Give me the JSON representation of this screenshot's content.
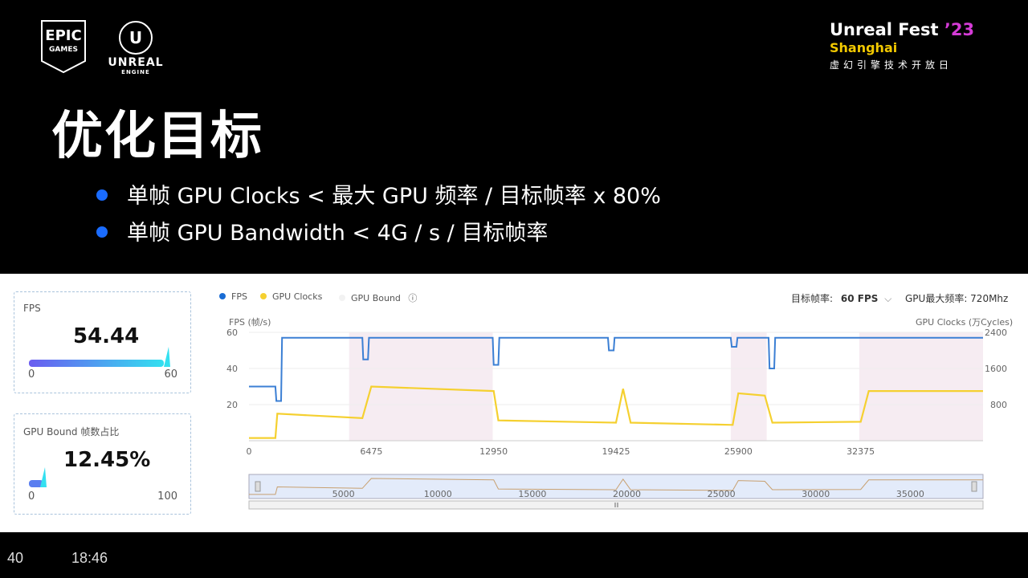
{
  "logos": {
    "epic_l1": "EPIC",
    "epic_l2": "GAMES",
    "unreal_l1": "UNREAL",
    "unreal_l2": "ENGINE"
  },
  "event": {
    "name": "Unreal Fest",
    "year": "’23",
    "city": "Shanghai",
    "subtitle": "虚幻引擎技术开放日"
  },
  "slide": {
    "title": "优化目标",
    "bullets": [
      "单帧 GPU Clocks < 最大 GPU 频率 / 目标帧率 x 80%",
      "单帧 GPU Bandwidth  < 4G / s  / 目标帧率"
    ]
  },
  "fps_card": {
    "label": "FPS",
    "value": "54.44",
    "min": "0",
    "max": "60"
  },
  "gpu_card": {
    "label": "GPU Bound 帧数占比",
    "value": "12.45%",
    "min": "0",
    "max": "100"
  },
  "chart_header": {
    "legend": [
      "FPS",
      "GPU Clocks",
      "GPU Bound"
    ],
    "target_fps_label": "目标帧率:",
    "target_fps_value": "60 FPS",
    "gpu_max_freq": "GPU最大频率: 720Mhz"
  },
  "colors": {
    "fps": "#3b7fd4",
    "gpu_clocks": "#f5d030",
    "gpu_bound": "#f0e0ea",
    "accent": "#1a6cff",
    "year": "#d43bd6"
  },
  "chart_data": {
    "type": "line",
    "y_left_label": "FPS (帧/s)",
    "y_right_label": "GPU Clocks (万Cycles)",
    "y_left_ticks": [
      "60",
      "40",
      "20"
    ],
    "y_right_ticks": [
      "2400",
      "1600",
      "800"
    ],
    "ylim_left": [
      0,
      60
    ],
    "ylim_right": [
      0,
      2400
    ],
    "x_ticks": [
      "0",
      "6475",
      "12950",
      "19425",
      "25900",
      "32375"
    ],
    "xlim": [
      0,
      38850
    ],
    "series": [
      {
        "name": "FPS",
        "x": [
          0,
          1400,
          1450,
          1700,
          1750,
          6000,
          6050,
          6300,
          6350,
          12900,
          12950,
          13200,
          13250,
          19000,
          19050,
          19300,
          19350,
          25500,
          25550,
          25800,
          25850,
          27500,
          27550,
          27800,
          27850,
          38850
        ],
        "values": [
          30,
          30,
          22,
          22,
          57,
          57,
          45,
          45,
          57,
          57,
          42,
          42,
          57,
          57,
          50,
          50,
          57,
          57,
          52,
          52,
          57,
          57,
          40,
          40,
          57,
          57
        ]
      },
      {
        "name": "GPU Clocks",
        "x": [
          0,
          1400,
          1500,
          6000,
          6475,
          12950,
          13200,
          19425,
          19800,
          20200,
          25600,
          25900,
          27300,
          27700,
          32375,
          32800,
          38850
        ],
        "values": [
          60,
          60,
          600,
          500,
          1200,
          1100,
          450,
          400,
          1150,
          400,
          350,
          1050,
          1000,
          400,
          420,
          1100,
          1100
        ]
      }
    ],
    "gpu_bound_bands": [
      [
        5300,
        12900
      ],
      [
        25500,
        27400
      ],
      [
        32300,
        38850
      ]
    ],
    "overview_ticks": [
      "5000",
      "10000",
      "15000",
      "20000",
      "25000",
      "30000",
      "35000"
    ]
  },
  "footer": {
    "page": "40",
    "time": "18:46"
  }
}
